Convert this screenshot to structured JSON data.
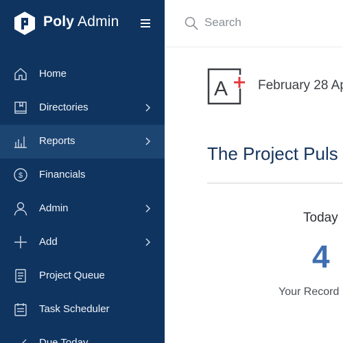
{
  "brand": {
    "name_bold": "Poly",
    "name_rest": " Admin"
  },
  "search": {
    "placeholder": "Search",
    "value": ""
  },
  "sidebar": {
    "items": [
      {
        "label": "Home",
        "icon": "home-icon",
        "has_submenu": false,
        "active": false
      },
      {
        "label": "Directories",
        "icon": "book-icon",
        "has_submenu": true,
        "active": false
      },
      {
        "label": "Reports",
        "icon": "bar-chart-icon",
        "has_submenu": true,
        "active": true
      },
      {
        "label": "Financials",
        "icon": "dollar-icon",
        "has_submenu": false,
        "active": false
      },
      {
        "label": "Admin",
        "icon": "user-icon",
        "has_submenu": true,
        "active": false
      },
      {
        "label": "Add",
        "icon": "plus-icon",
        "has_submenu": true,
        "active": false
      },
      {
        "label": "Project Queue",
        "icon": "document-icon",
        "has_submenu": false,
        "active": false
      },
      {
        "label": "Task Scheduler",
        "icon": "calendar-icon",
        "has_submenu": false,
        "active": false
      },
      {
        "label": "Due Today",
        "icon": "check-icon",
        "has_submenu": false,
        "active": false
      }
    ]
  },
  "main": {
    "logo_text": "A+",
    "date": "February 28 Ap",
    "title": "The Project Puls",
    "stat": {
      "label": "Today",
      "value": "4",
      "sublabel": "Your Record"
    }
  },
  "colors": {
    "sidebar_bg": "#0f3460",
    "sidebar_active": "#1d4572",
    "title": "#16355e",
    "stat_value": "#3f6fb0",
    "logo_plus": "#e03a3e"
  }
}
